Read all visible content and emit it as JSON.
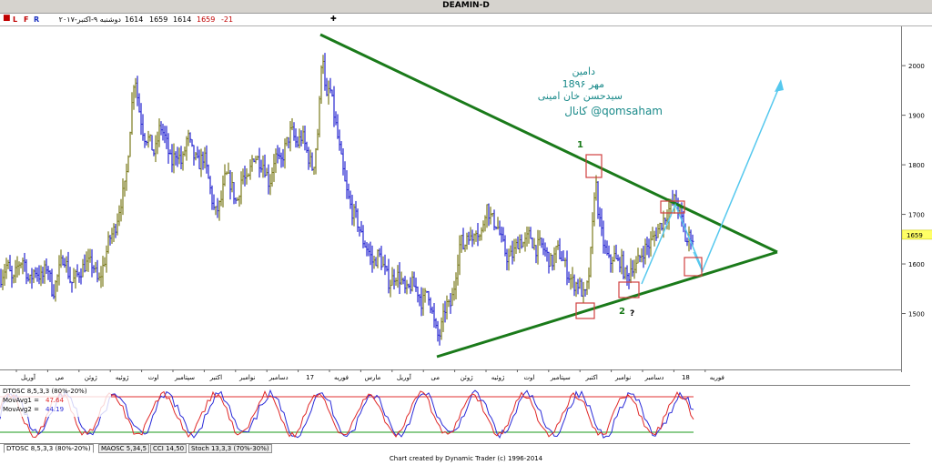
{
  "window": {
    "title": "DEAMIN-D"
  },
  "infobar": {
    "close": "■",
    "letters": [
      "L",
      "F",
      "R"
    ],
    "date": "دوشنبه ۹-اکتبر-۲۰۱۷",
    "open": "1614",
    "high": "1659",
    "low": "1614",
    "close_value": "1659",
    "change": "-21",
    "add": "✚"
  },
  "colors": {
    "up_bars": "#7a7a1c",
    "down_bars": "#2525d0",
    "trendlines": "#1a7a1a",
    "projection": "#55c8ee",
    "boxes": "#d04040",
    "annotation_text": "#1a8a8a",
    "price_tag": "#ffff66",
    "osc_blue": "#2a2ad8",
    "osc_red": "#e02828"
  },
  "annotation": {
    "line1": "دامین",
    "line2": "18مهر ۹۶",
    "line3": "سیدحسن خان امینی",
    "line4": "کانال @qomsaham"
  },
  "labels": {
    "one": "1",
    "two": "2",
    "question": "?"
  },
  "chart_data": [
    {
      "type": "bar",
      "subtype": "ohlc",
      "ylim": [
        1400,
        2070
      ],
      "yticks": [
        "1500",
        "1600",
        "1700",
        "1800",
        "1900",
        "2000"
      ],
      "last_price": "1659",
      "time_labels": [
        "آوریل",
        "می",
        "ژوئن",
        "ژوئیه",
        "اوت",
        "سپتامبر",
        "اکتبر",
        "نوامبر",
        "دسامبر",
        "17",
        "فوریه",
        "مارس",
        "آوریل",
        "می",
        "ژوئن",
        "ژوئیه",
        "اوت",
        "سپتامبر",
        "اکتبر",
        "نوامبر",
        "دسامبر",
        "18",
        "فوریه"
      ],
      "close_path": [
        [
          0,
          1570
        ],
        [
          8,
          1600
        ],
        [
          14,
          1560
        ],
        [
          20,
          1600
        ],
        [
          26,
          1610
        ],
        [
          32,
          1560
        ],
        [
          38,
          1590
        ],
        [
          46,
          1570
        ],
        [
          52,
          1600
        ],
        [
          58,
          1540
        ],
        [
          64,
          1580
        ],
        [
          70,
          1620
        ],
        [
          78,
          1560
        ],
        [
          86,
          1580
        ],
        [
          94,
          1600
        ],
        [
          102,
          1600
        ],
        [
          108,
          1560
        ],
        [
          114,
          1600
        ],
        [
          120,
          1650
        ],
        [
          126,
          1670
        ],
        [
          132,
          1720
        ],
        [
          138,
          1760
        ],
        [
          144,
          1900
        ],
        [
          148,
          1990
        ],
        [
          152,
          1920
        ],
        [
          158,
          1860
        ],
        [
          164,
          1850
        ],
        [
          170,
          1820
        ],
        [
          176,
          1880
        ],
        [
          182,
          1850
        ],
        [
          188,
          1800
        ],
        [
          194,
          1830
        ],
        [
          200,
          1800
        ],
        [
          206,
          1860
        ],
        [
          212,
          1820
        ],
        [
          218,
          1800
        ],
        [
          224,
          1820
        ],
        [
          230,
          1760
        ],
        [
          236,
          1700
        ],
        [
          242,
          1720
        ],
        [
          248,
          1780
        ],
        [
          254,
          1760
        ],
        [
          260,
          1720
        ],
        [
          266,
          1780
        ],
        [
          272,
          1760
        ],
        [
          278,
          1820
        ],
        [
          284,
          1810
        ],
        [
          290,
          1800
        ],
        [
          296,
          1760
        ],
        [
          302,
          1820
        ],
        [
          308,
          1800
        ],
        [
          314,
          1840
        ],
        [
          320,
          1870
        ],
        [
          326,
          1840
        ],
        [
          332,
          1860
        ],
        [
          338,
          1820
        ],
        [
          344,
          1790
        ],
        [
          350,
          1880
        ],
        [
          354,
          2050
        ],
        [
          358,
          1920
        ],
        [
          362,
          1960
        ],
        [
          368,
          1890
        ],
        [
          374,
          1820
        ],
        [
          380,
          1750
        ],
        [
          386,
          1710
        ],
        [
          392,
          1690
        ],
        [
          398,
          1650
        ],
        [
          404,
          1630
        ],
        [
          410,
          1600
        ],
        [
          416,
          1620
        ],
        [
          422,
          1590
        ],
        [
          428,
          1560
        ],
        [
          434,
          1580
        ],
        [
          440,
          1570
        ],
        [
          446,
          1540
        ],
        [
          452,
          1560
        ],
        [
          458,
          1550
        ],
        [
          464,
          1520
        ],
        [
          470,
          1550
        ],
        [
          474,
          1510
        ],
        [
          478,
          1470
        ],
        [
          482,
          1450
        ],
        [
          486,
          1480
        ],
        [
          490,
          1520
        ],
        [
          494,
          1510
        ],
        [
          498,
          1540
        ],
        [
          502,
          1600
        ],
        [
          506,
          1650
        ],
        [
          510,
          1630
        ],
        [
          514,
          1670
        ],
        [
          518,
          1640
        ],
        [
          522,
          1680
        ],
        [
          528,
          1650
        ],
        [
          534,
          1720
        ],
        [
          540,
          1690
        ],
        [
          546,
          1680
        ],
        [
          552,
          1640
        ],
        [
          558,
          1610
        ],
        [
          564,
          1620
        ],
        [
          570,
          1650
        ],
        [
          576,
          1640
        ],
        [
          582,
          1660
        ],
        [
          588,
          1630
        ],
        [
          594,
          1640
        ],
        [
          600,
          1620
        ],
        [
          606,
          1600
        ],
        [
          612,
          1630
        ],
        [
          618,
          1610
        ],
        [
          624,
          1580
        ],
        [
          630,
          1560
        ],
        [
          636,
          1560
        ],
        [
          642,
          1530
        ],
        [
          646,
          1560
        ],
        [
          650,
          1640
        ],
        [
          654,
          1780
        ],
        [
          658,
          1690
        ],
        [
          662,
          1650
        ],
        [
          666,
          1620
        ],
        [
          670,
          1600
        ],
        [
          674,
          1620
        ],
        [
          678,
          1600
        ],
        [
          682,
          1610
        ],
        [
          686,
          1580
        ],
        [
          690,
          1570
        ],
        [
          694,
          1600
        ],
        [
          698,
          1590
        ],
        [
          702,
          1610
        ],
        [
          708,
          1630
        ],
        [
          714,
          1640
        ],
        [
          720,
          1660
        ],
        [
          726,
          1680
        ],
        [
          732,
          1700
        ],
        [
          738,
          1720
        ],
        [
          742,
          1730
        ],
        [
          746,
          1710
        ],
        [
          750,
          1680
        ],
        [
          754,
          1640
        ],
        [
          758,
          1660
        ],
        [
          762,
          1650
        ]
      ]
    },
    {
      "type": "line",
      "name": "DTOSC 8,5,3,3 (80%-20%)",
      "ylim": [
        0,
        100
      ],
      "upper_level": 80,
      "lower_level": 20,
      "series": [
        {
          "name": "MovAvg1",
          "value_label": "47.64"
        },
        {
          "name": "MovAvg2",
          "value_label": "44.19"
        }
      ],
      "period_points": 9,
      "amplitude": 40
    }
  ],
  "osc_labels": {
    "title": "DTOSC 8,5,3,3 (80%-20%)",
    "ma1_label": "MovAvg1 =",
    "ma1_value": "47.64",
    "ma2_label": "MovAvg2 =",
    "ma2_value": "44.19"
  },
  "tabs": [
    "DTOSC 8,5,3,3 (80%-20%)",
    "MAOSC 5,34,5",
    "CCI 14,50",
    "Stoch 13,3,3 (70%-30%)"
  ],
  "footer": "Chart created by Dynamic Trader  (c) 1996-2014"
}
